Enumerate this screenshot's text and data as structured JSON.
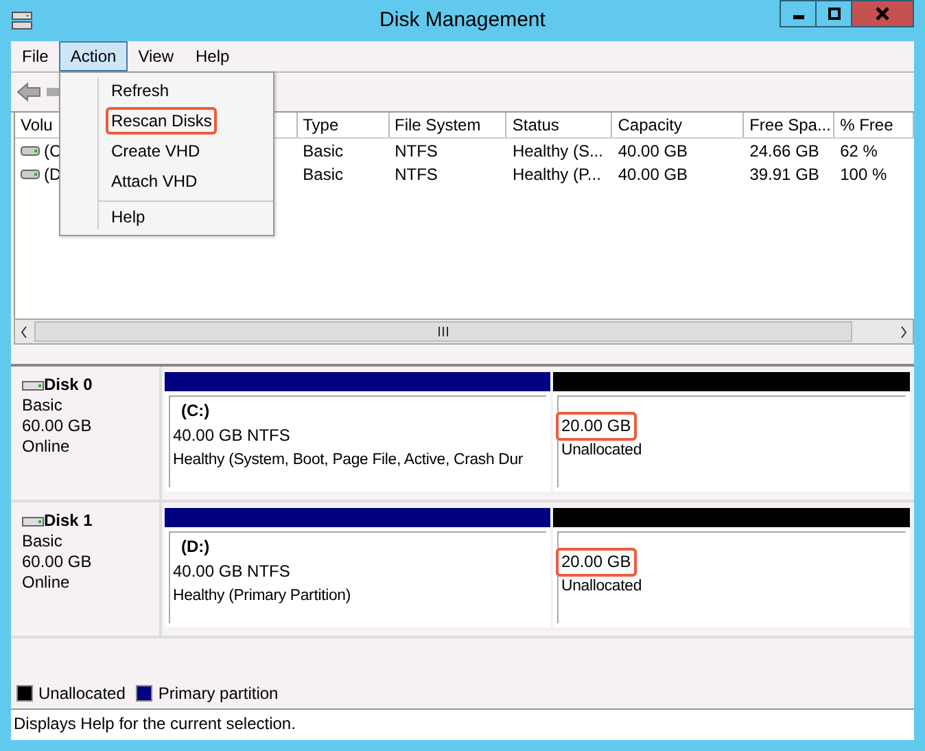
{
  "window": {
    "title": "Disk Management"
  },
  "menu_bar": [
    {
      "label": "File",
      "selected": false
    },
    {
      "label": "Action",
      "selected": true
    },
    {
      "label": "View",
      "selected": false
    },
    {
      "label": "Help",
      "selected": false
    }
  ],
  "action_menu": [
    {
      "items": [
        {
          "label": "Refresh",
          "highlighted": false
        },
        {
          "label": "Rescan Disks",
          "highlighted": true
        },
        {
          "label": "Create VHD",
          "highlighted": false
        },
        {
          "label": "Attach VHD",
          "highlighted": false
        }
      ]
    },
    {
      "items": [
        {
          "label": "Help",
          "highlighted": false
        }
      ]
    }
  ],
  "volume_table": {
    "columns": [
      "Volu",
      "Type",
      "File System",
      "Status",
      "Capacity",
      "Free Spa...",
      "% Free"
    ],
    "rows": [
      [
        "(C",
        "Basic",
        "NTFS",
        "Healthy (S...",
        "40.00 GB",
        "24.66 GB",
        "62 %"
      ],
      [
        "(D",
        "Basic",
        "NTFS",
        "Healthy (P...",
        "40.00 GB",
        "39.91 GB",
        "100 %"
      ]
    ]
  },
  "disks": [
    {
      "name": "Disk 0",
      "type": "Basic",
      "size": "60.00 GB",
      "state": "Online",
      "partitions": [
        {
          "kind": "primary",
          "label": "(C:)",
          "size": "40.00 GB NTFS",
          "status": "Healthy (System, Boot, Page File, Active, Crash Dur",
          "highlighted": false
        },
        {
          "kind": "unallocated",
          "size": "20.00 GB",
          "status": "Unallocated",
          "highlighted": true
        }
      ]
    },
    {
      "name": "Disk 1",
      "type": "Basic",
      "size": "60.00 GB",
      "state": "Online",
      "partitions": [
        {
          "kind": "primary",
          "label": "(D:)",
          "size": "40.00 GB NTFS",
          "status": "Healthy (Primary Partition)",
          "highlighted": false
        },
        {
          "kind": "unallocated",
          "size": "20.00 GB",
          "status": "Unallocated",
          "highlighted": true
        }
      ]
    }
  ],
  "legend": [
    {
      "label": "Unallocated",
      "color": "#000000"
    },
    {
      "label": "Primary partition",
      "color": "#000080"
    }
  ],
  "status_bar": "Displays Help for the current selection."
}
